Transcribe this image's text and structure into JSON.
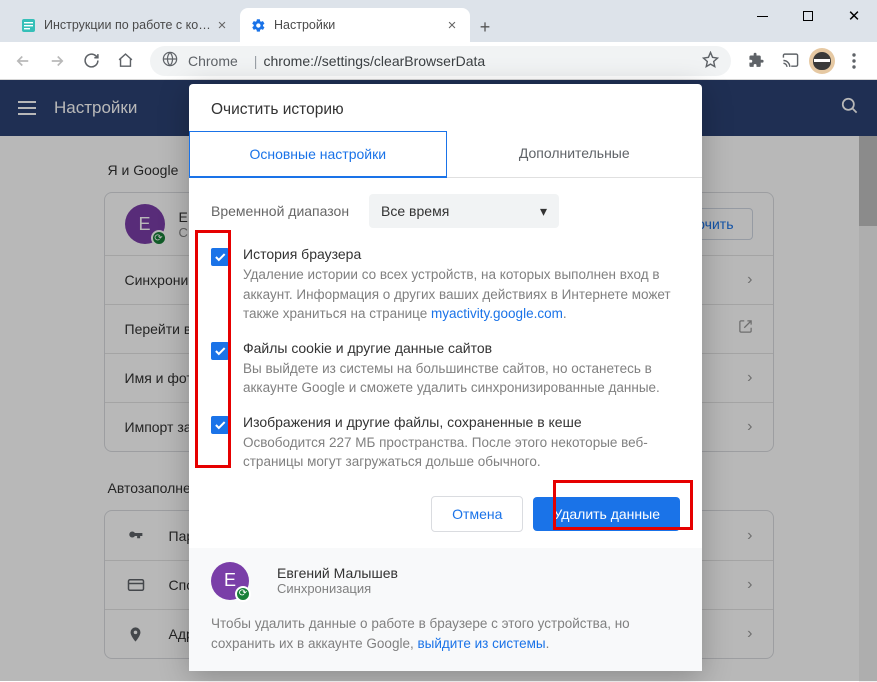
{
  "window": {
    "tabs": [
      {
        "title": "Инструкции по работе с компь"
      },
      {
        "title": "Настройки"
      }
    ]
  },
  "toolbar": {
    "chrome_label": "Chrome",
    "url": "chrome://settings/clearBrowserData"
  },
  "settings_header": {
    "title": "Настройки"
  },
  "page": {
    "section1_label": "Я и Google",
    "profile_letter": "Е",
    "profile_line1": "Е",
    "profile_line2": "С",
    "enable_btn": "ючить",
    "rows1": [
      "Синхрони",
      "Перейти в",
      "Имя и фот",
      "Импорт за"
    ],
    "section2_label": "Автозаполнение",
    "rows2": [
      "Пар",
      "Спс",
      "Адр"
    ]
  },
  "modal": {
    "title": "Очистить историю",
    "tabs": {
      "basic": "Основные настройки",
      "advanced": "Дополнительные"
    },
    "time_label": "Временной диапазон",
    "time_value": "Все время",
    "items": [
      {
        "title": "История браузера",
        "desc_pre": "Удаление истории со всех устройств, на которых выполнен вход в аккаунт. Информация о других ваших действиях в Интернете может также храниться на странице ",
        "link": "myactivity.google.com",
        "desc_post": "."
      },
      {
        "title": "Файлы cookie и другие данные сайтов",
        "desc_pre": "Вы выйдете из системы на большинстве сайтов, но останетесь в аккаунте Google и сможете удалить синхронизированные данные.",
        "link": "",
        "desc_post": ""
      },
      {
        "title": "Изображения и другие файлы, сохраненные в кеше",
        "desc_pre": "Освободится 227 МБ пространства. После этого некоторые веб-страницы могут загружаться дольше обычного.",
        "link": "",
        "desc_post": ""
      }
    ],
    "cancel": "Отмена",
    "confirm": "Удалить данные",
    "user_letter": "Е",
    "user_name": "Евгений Малышев",
    "user_sub": "Синхронизация",
    "footer_pre": "Чтобы удалить данные о работе в браузере с этого устройства, но сохранить их в аккаунте Google, ",
    "footer_link": "выйдите из системы",
    "footer_post": "."
  }
}
